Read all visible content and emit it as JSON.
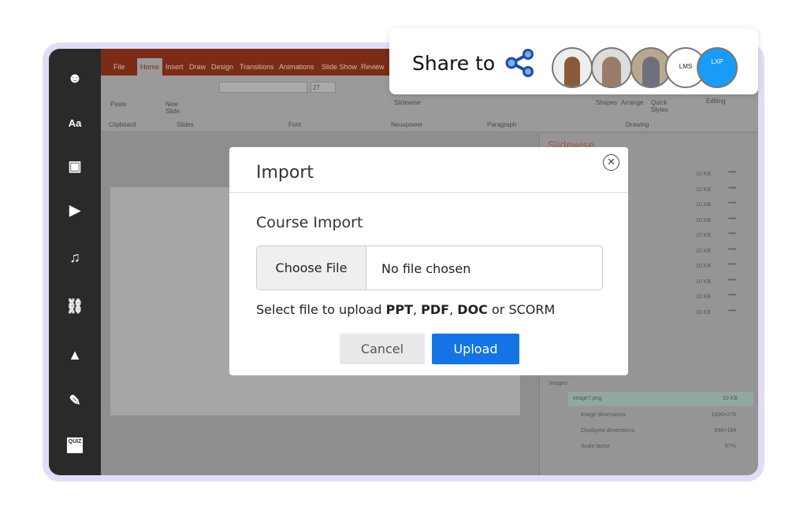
{
  "ribbon": {
    "tabs": [
      "File",
      "Home",
      "Insert",
      "Draw",
      "Design",
      "Transitions",
      "Animations",
      "Slide Show",
      "Review"
    ],
    "groups": [
      "Clipboard",
      "Slides",
      "Font",
      "Neuxpower",
      "Paragraph",
      "Drawing"
    ],
    "buttons": {
      "paste": "Paste",
      "new_slide": "New Slide",
      "slidewise": "Slidewise",
      "shapes": "Shapes",
      "arrange": "Arrange",
      "quick_styles": "Quick Styles",
      "editing": "Editing"
    },
    "font_size": "27"
  },
  "sidebar": {
    "icons": [
      "theater-mask-icon",
      "text-icon",
      "image-icon",
      "video-icon",
      "music-icon",
      "link-icon",
      "shapes-icon",
      "pencil-icon",
      "quiz-icon"
    ],
    "text_icon_label": "Aa",
    "quiz_label": "QUIZ"
  },
  "share": {
    "label": "Share to",
    "icon": "share-icon",
    "targets": [
      "LMS",
      "LXP"
    ],
    "accent": "#1a9bf5"
  },
  "pane": {
    "title": "Slidewise",
    "rows": [
      "10 KB",
      "10 KB",
      "10 KB",
      "10 KB",
      "10 KB",
      "10 KB",
      "10 KB",
      "10 KB",
      "10 KB",
      "10 KB"
    ],
    "images_label": "Images",
    "file": "image7.png",
    "file_size": "10 KB",
    "props": [
      {
        "k": "Image dimensions",
        "v": "1000×276"
      },
      {
        "k": "Displayed dimensions",
        "v": "666×184"
      },
      {
        "k": "Scale factor",
        "v": "67%"
      }
    ]
  },
  "dialog": {
    "title": "Import",
    "subtitle": "Course Import",
    "choose_file": "Choose File",
    "no_file": "No file chosen",
    "hint_prefix": "Select file to upload ",
    "f1": "PPT",
    ",1": ", ",
    "f2": "PDF",
    "f3": "DOC",
    "hint_suffix": " or SCORM",
    "sep": ", ",
    "cancel": "Cancel",
    "upload": "Upload",
    "accent": "#1474e6"
  }
}
